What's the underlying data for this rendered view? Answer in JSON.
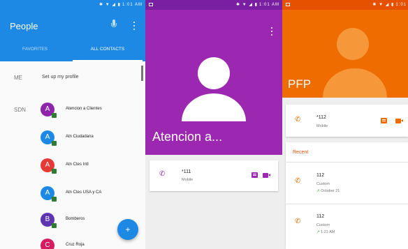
{
  "colors": {
    "people_blue": "#1e88e5",
    "purple": "#9c27b0",
    "orange": "#ef6c00",
    "avatar_purple": "#8e24aa",
    "avatar_blue": "#1e88e5",
    "avatar_red": "#e53935",
    "avatar_violet": "#5e35b1",
    "avatar_pink": "#d81b60",
    "received_arrow": "#43a047"
  },
  "status_bar": {
    "s1_time": "1:01 AM",
    "s2_time": "1:01 AM",
    "s3_time": "1:01"
  },
  "people": {
    "title": "People",
    "mic_icon": "mic-icon",
    "menu_icon": "more-vert-icon",
    "tabs": [
      {
        "label": "FAVORITES",
        "selected": false
      },
      {
        "label": "ALL CONTACTS",
        "selected": true
      }
    ],
    "me_label": "ME",
    "me_text": "Set up my profile",
    "sdn_label": "SDN",
    "contacts": [
      {
        "initial": "A",
        "name": "Atencion a Clientes",
        "color": "#8e24aa"
      },
      {
        "initial": "A",
        "name": "Atn Ciudadana",
        "color": "#1e88e5"
      },
      {
        "initial": "A",
        "name": "Atn Ctes Intl",
        "color": "#e53935"
      },
      {
        "initial": "A",
        "name": "Atn Ctes USA y CA",
        "color": "#1e88e5"
      },
      {
        "initial": "B",
        "name": "Bomberos",
        "color": "#5e35b1"
      },
      {
        "initial": "C",
        "name": "Cruz Roja",
        "color": "#d81b60"
      }
    ],
    "fab_icon": "add-contact-icon"
  },
  "contact_purple": {
    "name": "Atencion a...",
    "number": "*111",
    "type": "Mobile"
  },
  "contact_orange": {
    "name": "PFP",
    "number": "*112",
    "type": "Mobile",
    "recent_title": "Recent",
    "recent": [
      {
        "number": "112",
        "label": "Custom",
        "time": "October 21"
      },
      {
        "number": "112",
        "label": "Custom",
        "time": "1:21 AM"
      }
    ]
  }
}
